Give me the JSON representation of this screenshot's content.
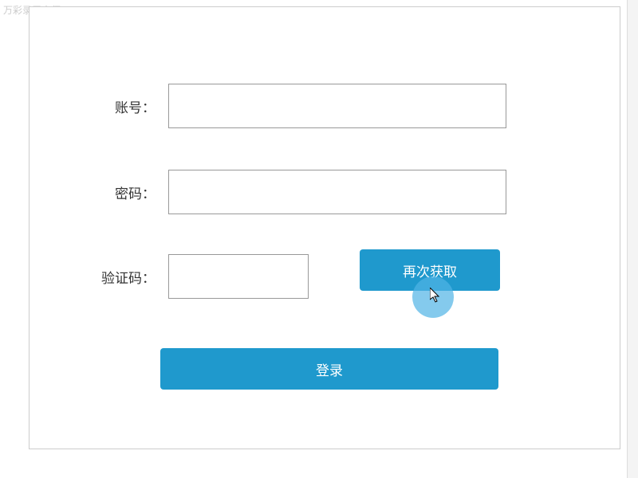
{
  "watermark": "万彩录屏大师",
  "form": {
    "account_label": "账号：",
    "account_value": "",
    "password_label": "密码：",
    "password_value": "",
    "captcha_label": "验证码：",
    "captcha_value": "",
    "get_captcha_button": "再次获取",
    "login_button": "登录"
  },
  "colors": {
    "primary": "#1f99cd",
    "border": "#cccccc"
  }
}
